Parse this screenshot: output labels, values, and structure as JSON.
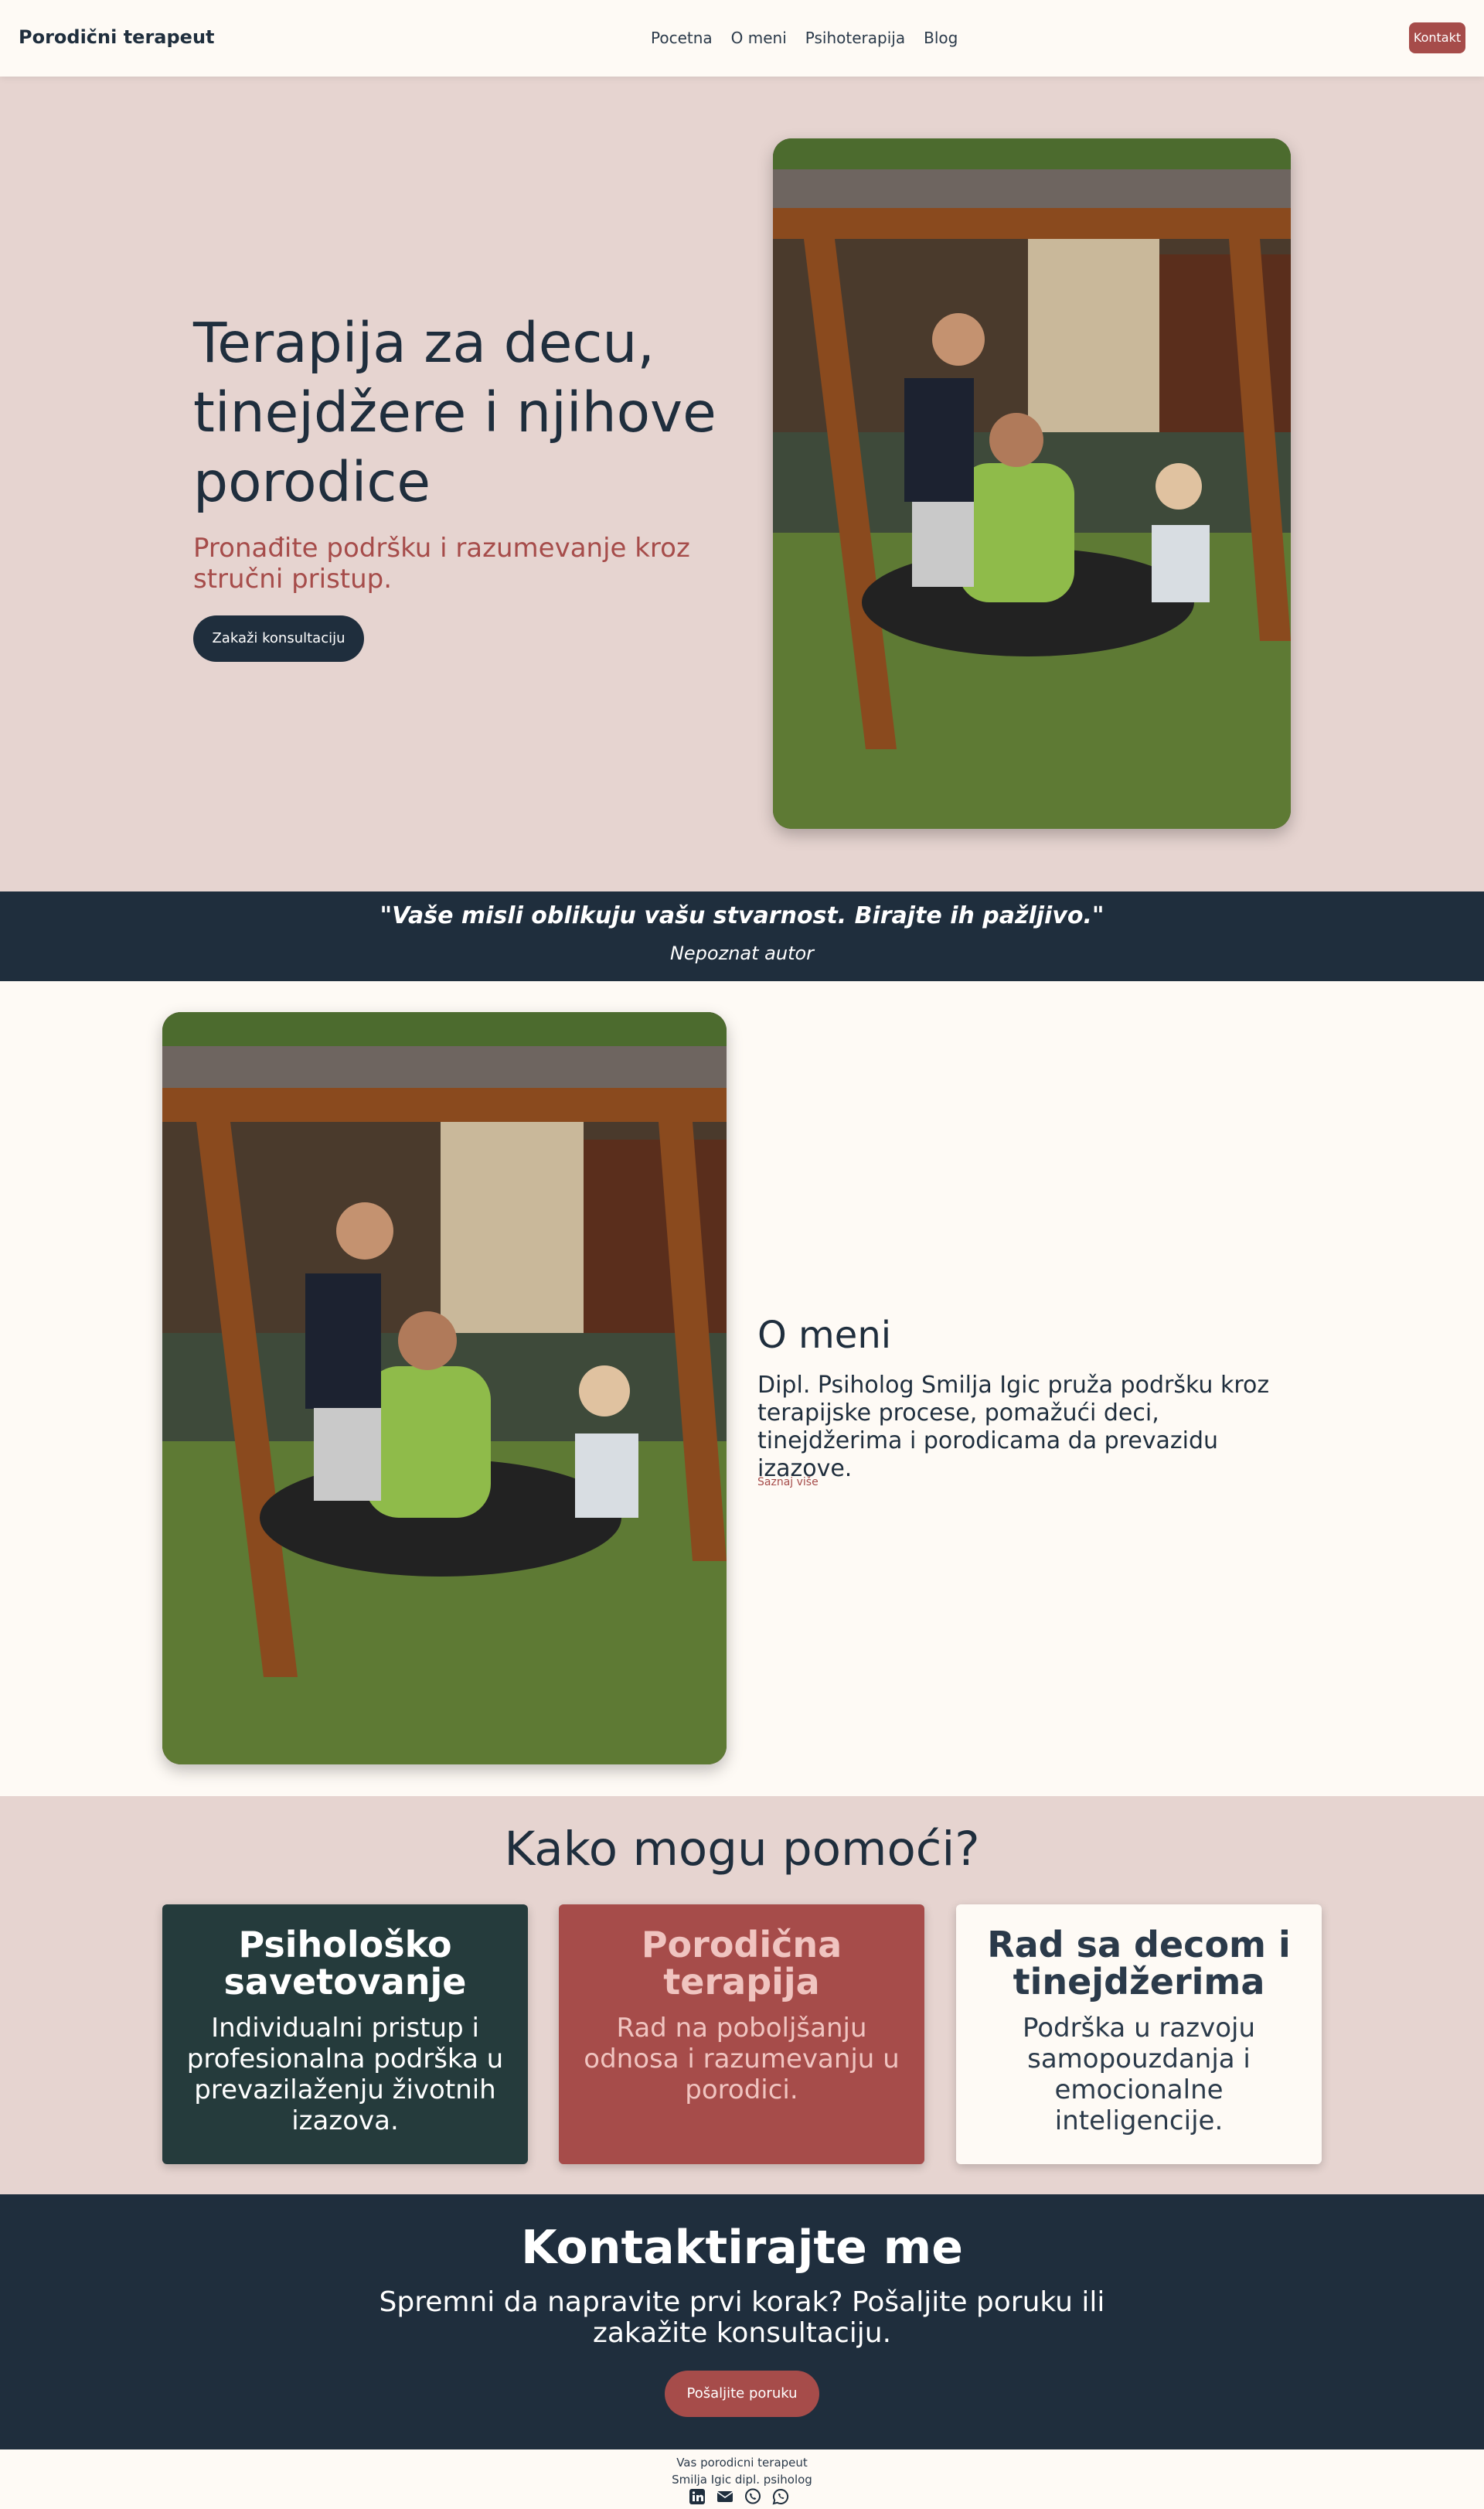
{
  "nav": {
    "brand": "Porodični terapeut",
    "links": [
      "Pocetna",
      "O meni",
      "Psihoterapija",
      "Blog"
    ],
    "contact_button": "Kontakt"
  },
  "hero": {
    "title": "Terapija za decu, tinejdžere i njihove porodice",
    "subtitle": "Pronađite podršku i razumevanje kroz stručni pristup.",
    "cta": "Zakaži konsultaciju"
  },
  "quote": {
    "text": "\"Vaše misli oblikuju vašu stvarnost. Birajte ih pažljivo.\"",
    "author": "Nepoznat autor"
  },
  "about": {
    "title": "O meni",
    "text": "Dipl. Psiholog Smilja Igic pruža podršku kroz terapijske procese, pomažući deci, tinejdžerima i porodicama da prevazidu izazove.",
    "link": "Saznaj više"
  },
  "services": {
    "title": "Kako mogu pomoći?",
    "cards": [
      {
        "title": "Psihološko savetovanje",
        "text": "Individualni pristup i profesionalna podrška u prevazilaženju životnih izazova."
      },
      {
        "title": "Porodična terapija",
        "text": "Rad na poboljšanju odnosa i razumevanju u porodici."
      },
      {
        "title": "Rad sa decom i tinejdžerima",
        "text": "Podrška u razvoju samopouzdanja i emocionalne inteligencije."
      }
    ]
  },
  "contact": {
    "title": "Kontaktirajte me",
    "text": "Spremni da napravite prvi korak? Pošaljite poruku ili zakažite konsultaciju.",
    "button": "Pošaljite poruku"
  },
  "footer": {
    "line1": "Vas porodicni terapeut",
    "line2": "Smilja Igic dipl. psiholog",
    "social_icons": [
      "linkedin-icon",
      "email-icon",
      "viber-icon",
      "whatsapp-icon"
    ]
  },
  "colors": {
    "navy": "#1f2e3d",
    "accent": "#a64c4a",
    "blush": "#e6d4d0",
    "cream": "#fefaf5",
    "forest": "#253b3c"
  }
}
